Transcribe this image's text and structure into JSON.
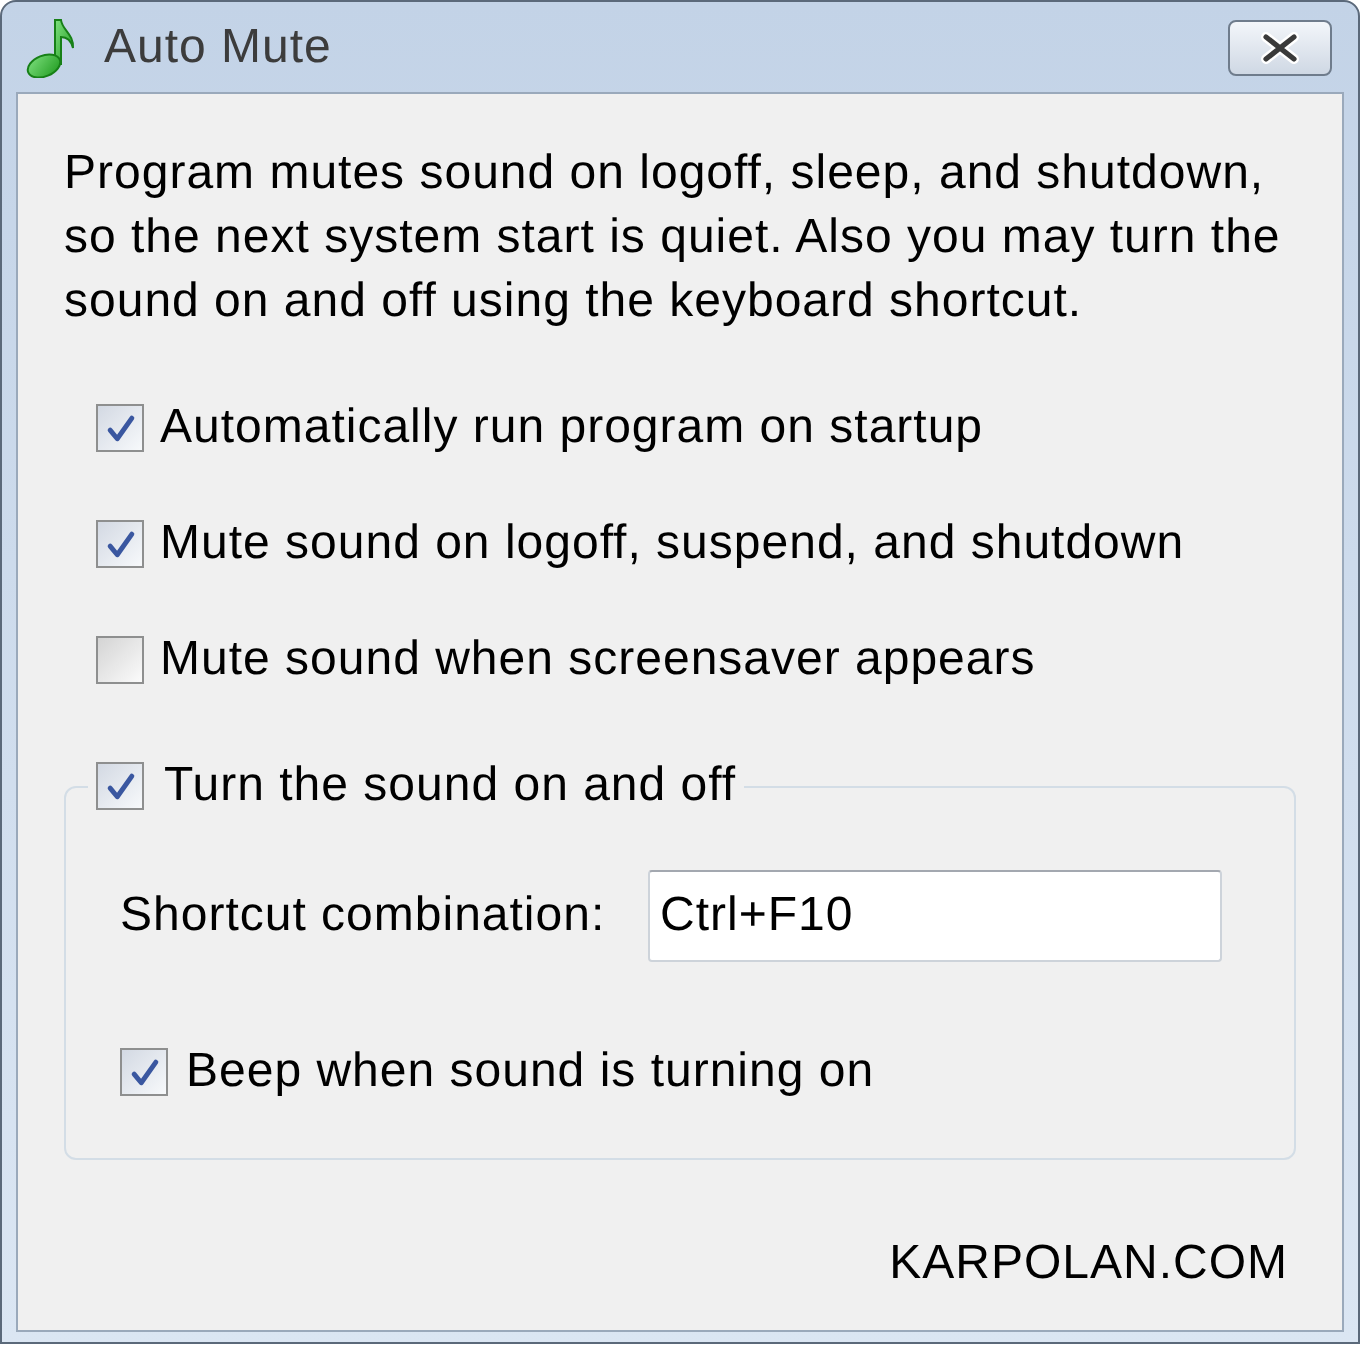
{
  "window": {
    "title": "Auto Mute"
  },
  "description": "Program mutes sound on logoff, sleep, and shutdown, so the next system start is quiet. Also you may turn the sound on and off using the keyboard shortcut.",
  "options": [
    {
      "label": "Automatically run program on startup",
      "checked": true
    },
    {
      "label": "Mute sound on logoff, suspend, and shutdown",
      "checked": true
    },
    {
      "label": "Mute sound when screensaver appears",
      "checked": false
    }
  ],
  "group": {
    "label": "Turn the sound on and off",
    "checked": true,
    "shortcut": {
      "label": "Shortcut combination:",
      "value": "Ctrl+F10"
    },
    "beep": {
      "label": "Beep when sound is turning on",
      "checked": true
    }
  },
  "website": "KARPOLAN.COM"
}
